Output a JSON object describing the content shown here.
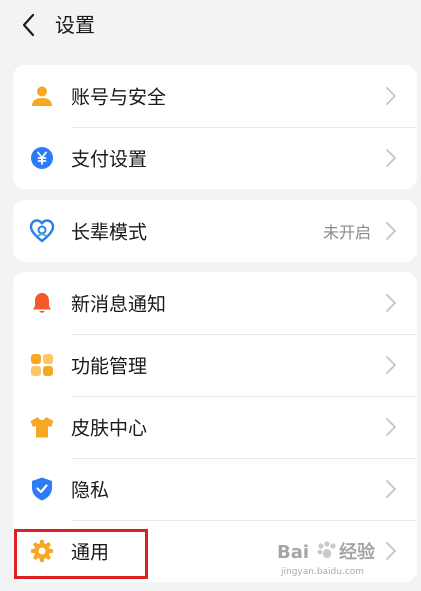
{
  "header": {
    "title": "设置"
  },
  "groups": [
    {
      "items": [
        {
          "label": "账号与安全",
          "icon": "user-icon"
        },
        {
          "label": "支付设置",
          "icon": "yuan-payment-icon"
        }
      ]
    },
    {
      "items": [
        {
          "label": "长辈模式",
          "value": "未开启",
          "icon": "heart-shield-icon"
        }
      ]
    },
    {
      "items": [
        {
          "label": "新消息通知",
          "icon": "bell-icon"
        },
        {
          "label": "功能管理",
          "icon": "grid-icon"
        },
        {
          "label": "皮肤中心",
          "icon": "shirt-icon"
        },
        {
          "label": "隐私",
          "icon": "shield-check-icon"
        },
        {
          "label": "通用",
          "icon": "gear-icon"
        }
      ]
    }
  ],
  "colors": {
    "background": "#f2f3f5",
    "card": "#ffffff",
    "orange": "#f7a823",
    "blue": "#2b7cf6",
    "red_highlight": "#e02020",
    "bell": "#f25a2c"
  }
}
